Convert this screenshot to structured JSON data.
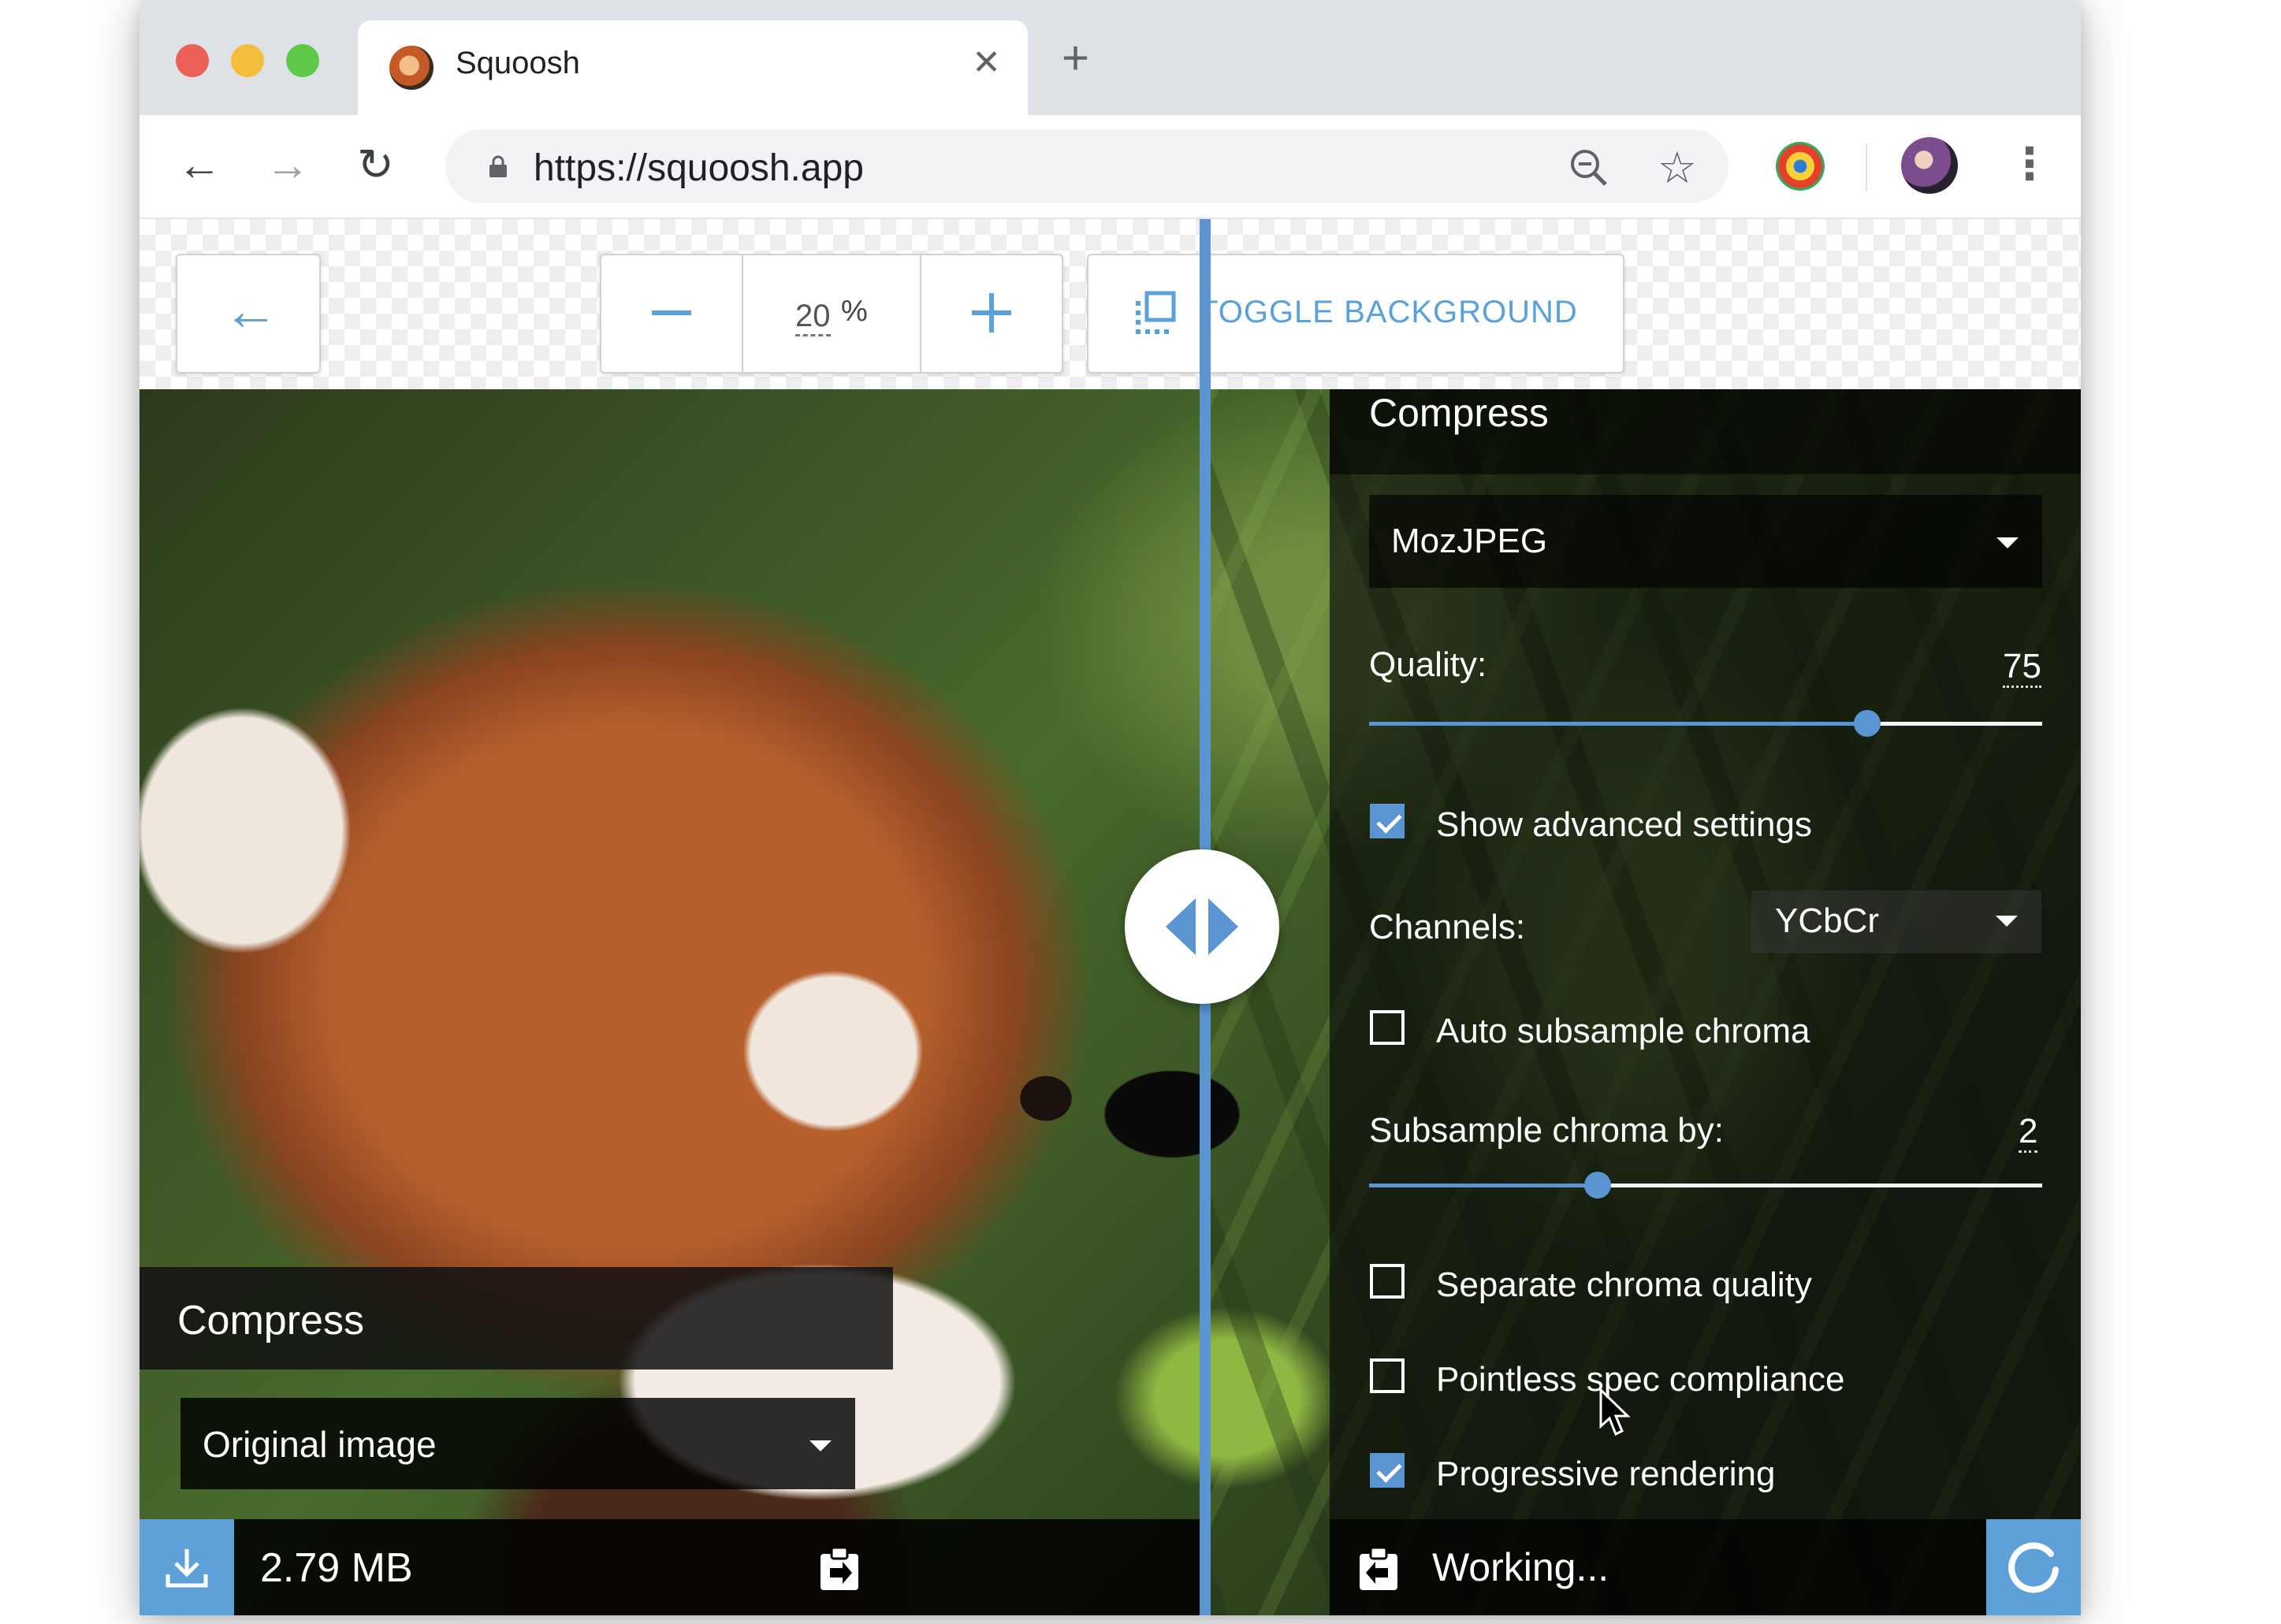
{
  "browser": {
    "tab_title": "Squoosh",
    "tab_close_glyph": "✕",
    "new_tab_glyph": "+",
    "url": "https://squoosh.app",
    "icons": [
      "back-icon",
      "forward-icon",
      "reload-icon",
      "lock-icon",
      "zoom-icon",
      "star-icon",
      "extension-icon",
      "profile-avatar",
      "menu-icon"
    ]
  },
  "toolbar": {
    "back_glyph": "←",
    "zoom_value": "20",
    "zoom_unit": "%",
    "toggle_background_label": "TOGGLE BACKGROUND"
  },
  "left": {
    "title": "Compress",
    "method": "Original image",
    "size": "2.79 MB"
  },
  "right": {
    "title": "Compress",
    "encoder": "MozJPEG",
    "quality_label": "Quality:",
    "quality_value": "75",
    "quality_fraction": 0.74,
    "show_advanced_label": "Show advanced settings",
    "show_advanced_checked": true,
    "channels_label": "Channels:",
    "channels_value": "YCbCr",
    "auto_subsample_label": "Auto subsample chroma",
    "auto_subsample_checked": false,
    "subsample_label": "Subsample chroma by:",
    "subsample_value": "2",
    "subsample_fraction": 0.34,
    "separate_chroma_label": "Separate chroma quality",
    "separate_chroma_checked": false,
    "pointless_spec_label": "Pointless spec compliance",
    "pointless_spec_checked": false,
    "progressive_label": "Progressive rendering",
    "progressive_checked": true,
    "status": "Working..."
  },
  "colors": {
    "accent": "#5a95d2",
    "tab_bar": "#dee1e6"
  }
}
